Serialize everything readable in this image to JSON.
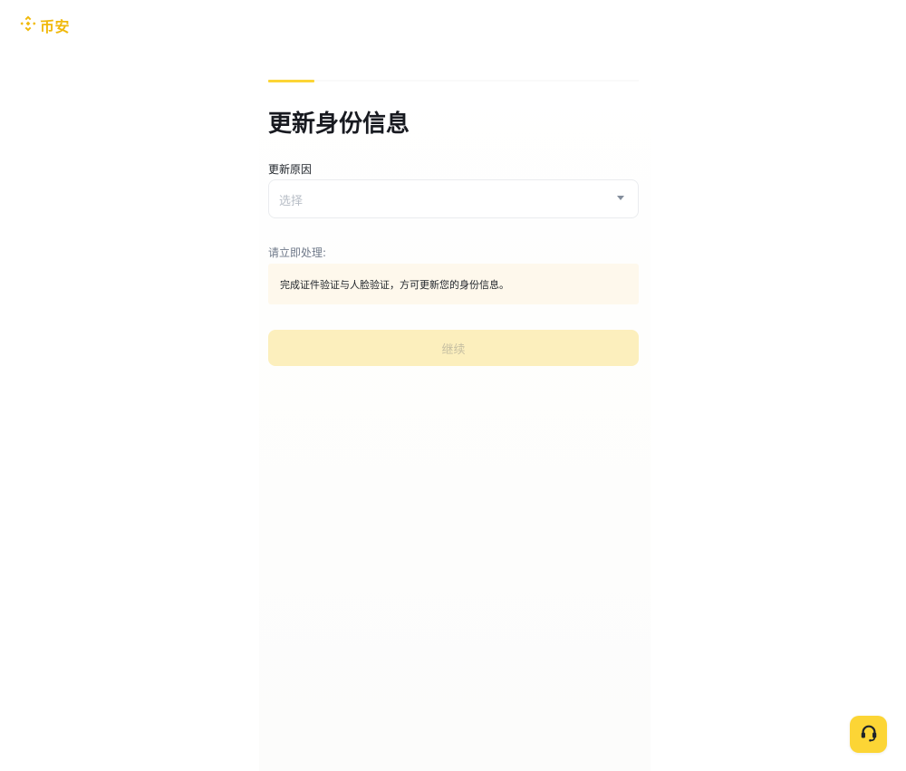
{
  "brand": {
    "name": "币安",
    "color": "#F0B90B"
  },
  "form": {
    "title": "更新身份信息",
    "progress": 0.125,
    "reason_label": "更新原因",
    "reason_placeholder": "选择",
    "notice_label": "请立即处理:",
    "notice_text": "完成证件验证与人脸验证，方可更新您的身份信息。",
    "continue_label": "继续"
  },
  "colors": {
    "accent": "#FCD535",
    "notice_bg": "#FEF8EC",
    "button_disabled_bg": "#FCEFBD"
  },
  "icons": {
    "dropdown": "caret-down-icon",
    "support": "headset-icon",
    "logo": "binance-diamond-icon"
  }
}
